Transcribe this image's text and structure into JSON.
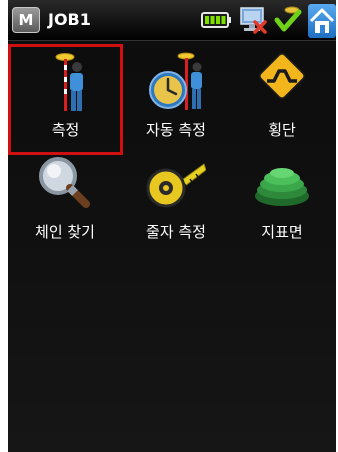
{
  "titlebar": {
    "menu_button_label": "M",
    "title": "JOB1",
    "icons": [
      "battery-icon",
      "network-disconnected-icon",
      "check-icon",
      "home-icon"
    ]
  },
  "tiles": [
    {
      "label": "측정",
      "icon": "survey-rod-icon",
      "selected": true
    },
    {
      "label": "자동 측정",
      "icon": "auto-measure-clock-icon",
      "selected": false
    },
    {
      "label": "횡단",
      "icon": "cross-section-sign-icon",
      "selected": false
    },
    {
      "label": "체인 찾기",
      "icon": "magnifier-icon",
      "selected": false
    },
    {
      "label": "줄자 측정",
      "icon": "tape-measure-icon",
      "selected": false
    },
    {
      "label": "지표면",
      "icon": "surface-layers-icon",
      "selected": false
    }
  ],
  "colors": {
    "selection_border": "#d01010",
    "background": "#111111",
    "text": "#ffffff"
  }
}
